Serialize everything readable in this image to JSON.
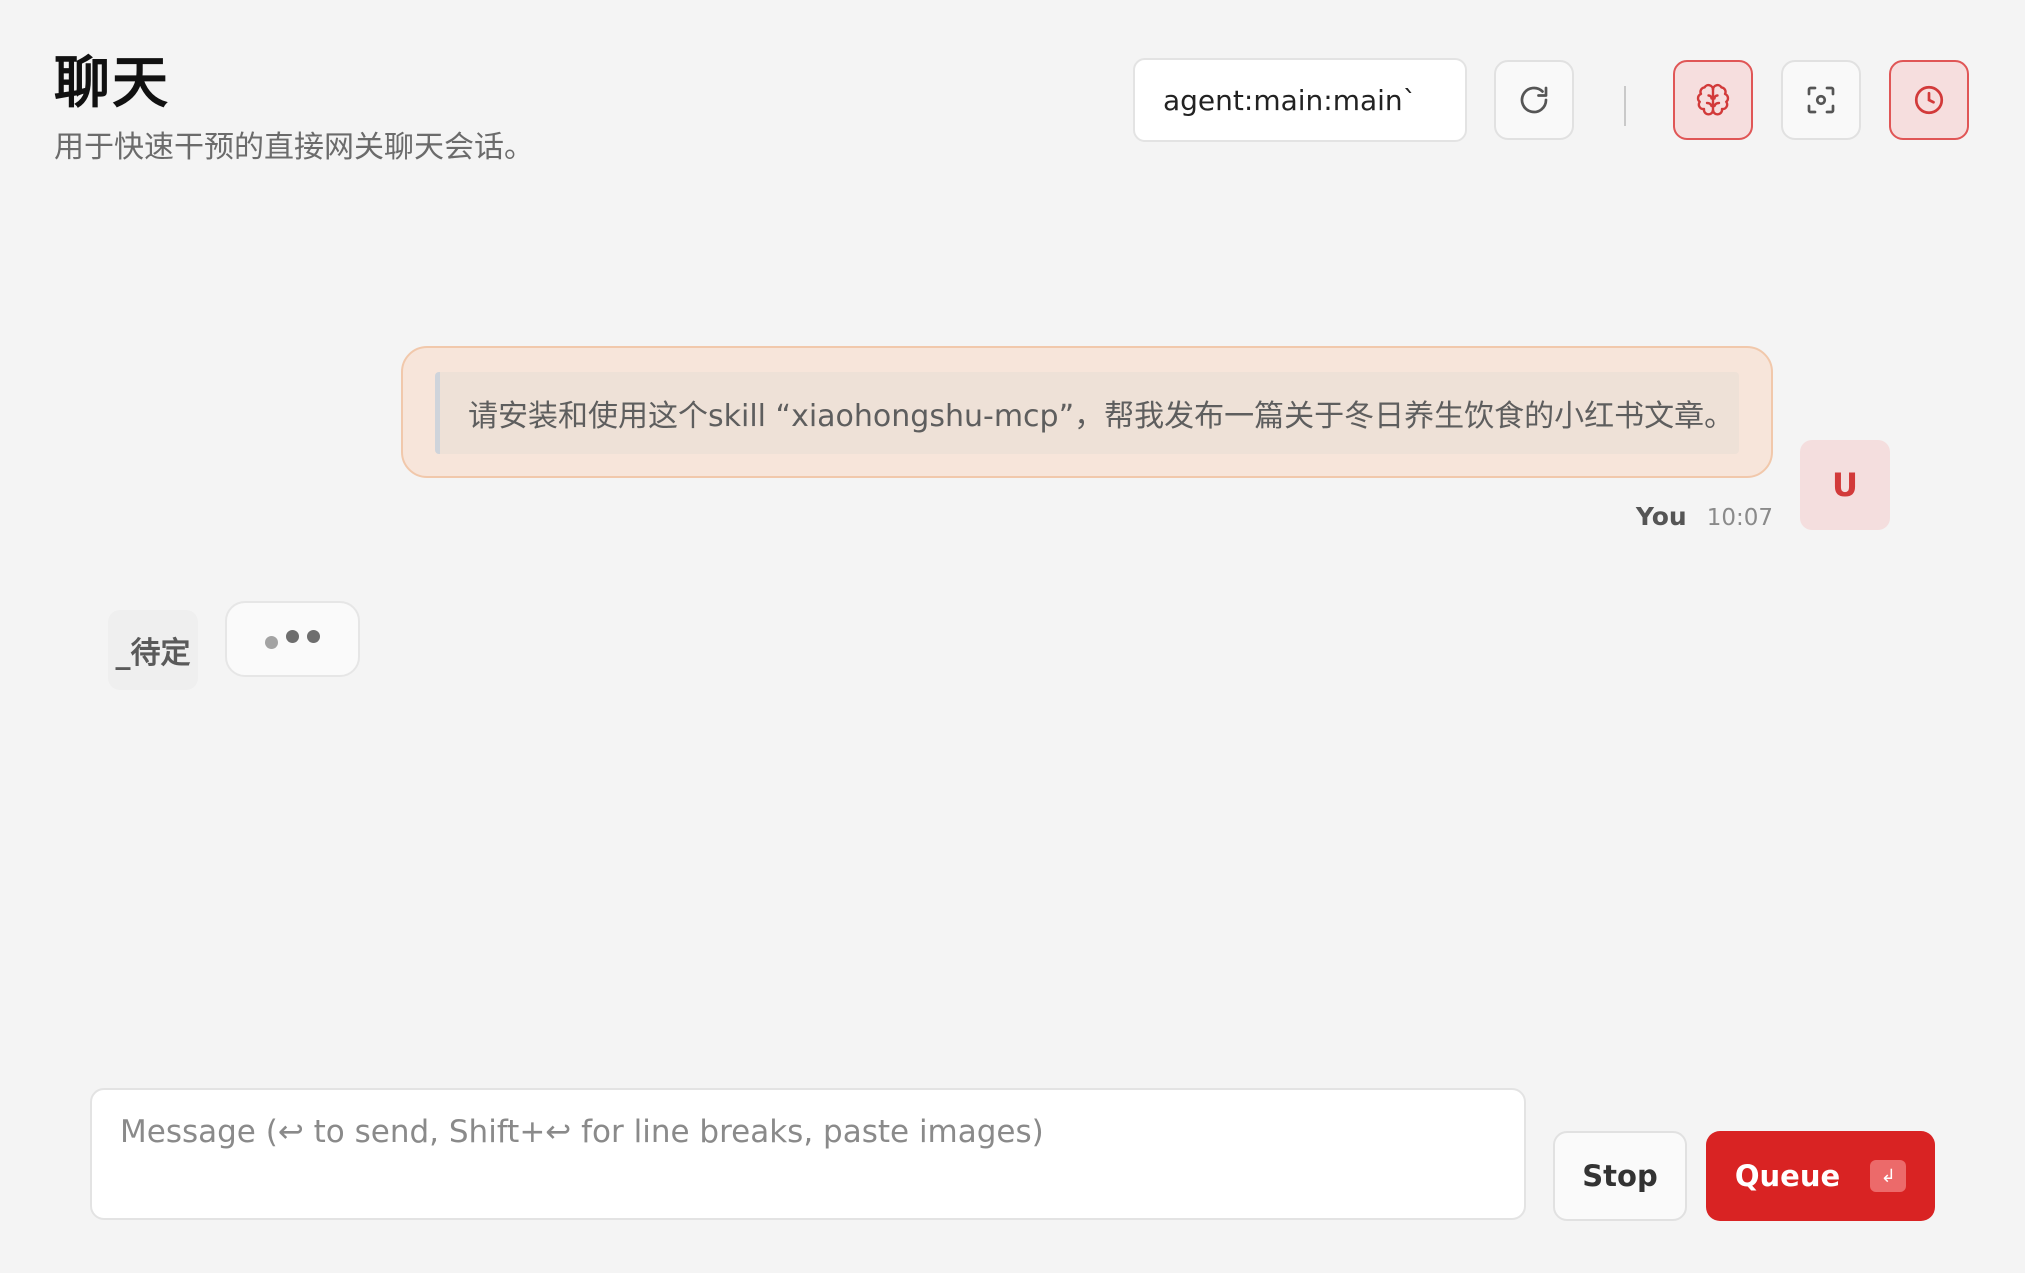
{
  "header": {
    "title": "聊天",
    "subtitle": "用于快速干预的直接网关聊天会话。",
    "session_value": "agent:main:main`"
  },
  "toolbar": {
    "refresh_icon": "refresh-icon",
    "thinking_icon": "brain-icon",
    "focus_icon": "focus-icon",
    "history_icon": "clock-icon",
    "accent_color": "#d92323"
  },
  "messages": {
    "user": {
      "text": "请安装和使用这个skill “xiaohongshu-mcp”，帮我发布一篇关于冬日养生饮食的小红书文章。",
      "sender": "You",
      "time": "10:07",
      "avatar": "U"
    },
    "assistant": {
      "avatar": "_待定"
    }
  },
  "composer": {
    "placeholder": "Message (↩ to send, Shift+↩ for line breaks, paste images)",
    "stop_label": "Stop",
    "queue_label": "Queue",
    "queue_kbd": "↲"
  }
}
